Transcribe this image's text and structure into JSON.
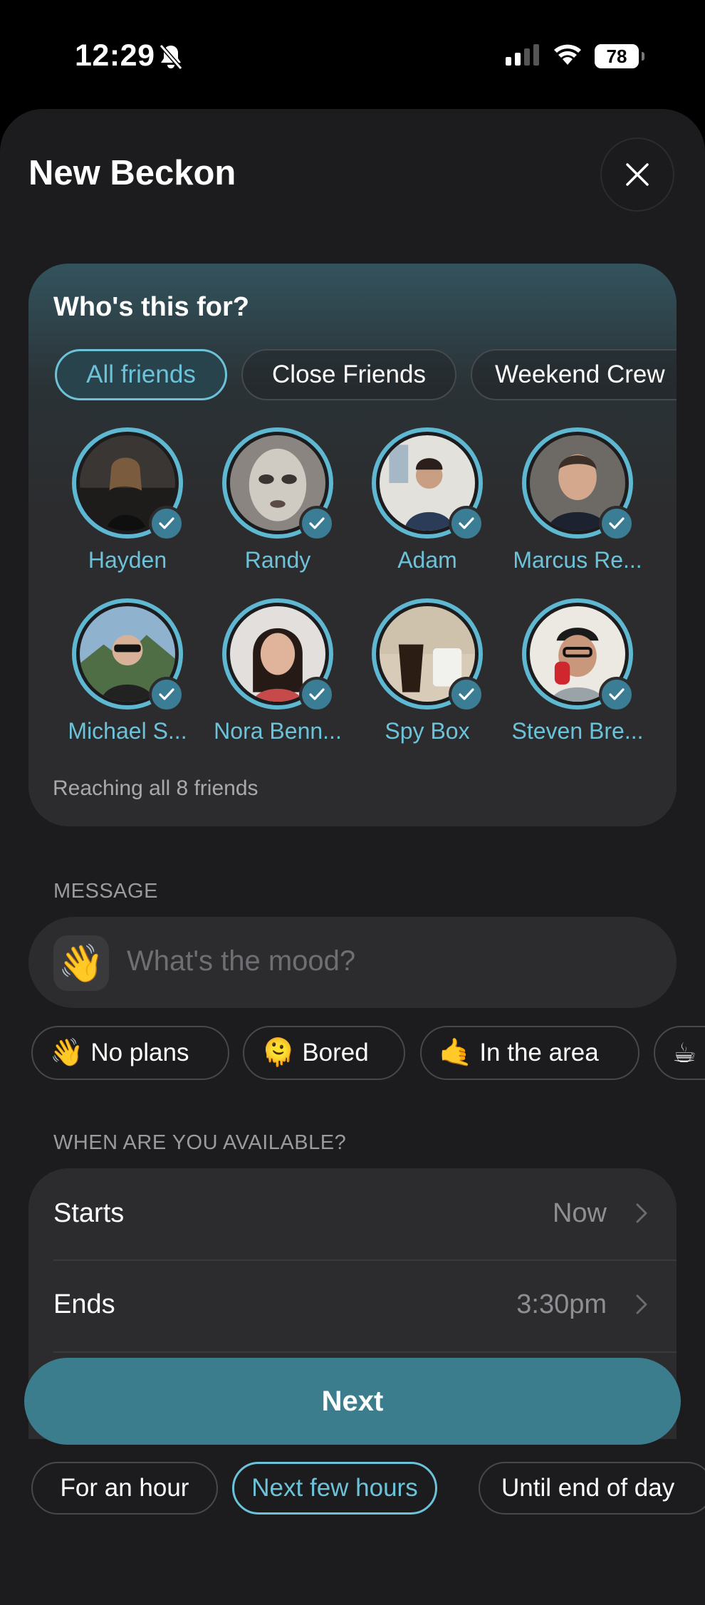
{
  "status": {
    "time": "12:29",
    "battery": "78"
  },
  "sheet": {
    "title": "New Beckon"
  },
  "audience": {
    "heading": "Who's this for?",
    "groups": [
      "All friends",
      "Close Friends",
      "Weekend Crew"
    ],
    "selected_group": "All friends",
    "friends": [
      {
        "name": "Hayden",
        "selected": true
      },
      {
        "name": "Randy",
        "selected": true
      },
      {
        "name": "Adam",
        "selected": true
      },
      {
        "name": "Marcus Re...",
        "selected": true
      },
      {
        "name": "Michael S...",
        "selected": true
      },
      {
        "name": "Nora Benn...",
        "selected": true
      },
      {
        "name": "Spy Box",
        "selected": true
      },
      {
        "name": "Steven Bre...",
        "selected": true
      }
    ],
    "reach_text": "Reaching all 8 friends"
  },
  "message": {
    "label": "MESSAGE",
    "emoji": "👋",
    "placeholder": "What's the mood?",
    "moods": [
      {
        "emoji": "👋",
        "label": "No plans"
      },
      {
        "emoji": "🫠",
        "label": "Bored"
      },
      {
        "emoji": "🤙",
        "label": "In the area"
      },
      {
        "emoji": "☕",
        "label": ""
      }
    ]
  },
  "availability": {
    "label": "WHEN ARE YOU AVAILABLE?",
    "starts_label": "Starts",
    "starts_value": "Now",
    "ends_label": "Ends",
    "ends_value": "3:30pm",
    "durations": [
      "For an hour",
      "Next few hours",
      "Until end of day"
    ],
    "selected_duration": "Next few hours"
  },
  "actions": {
    "next_label": "Next"
  },
  "colors": {
    "accent": "#6cc3d9",
    "button": "#3b7d8d",
    "sheet": "#1c1c1e",
    "card": "#2c2c2e"
  }
}
